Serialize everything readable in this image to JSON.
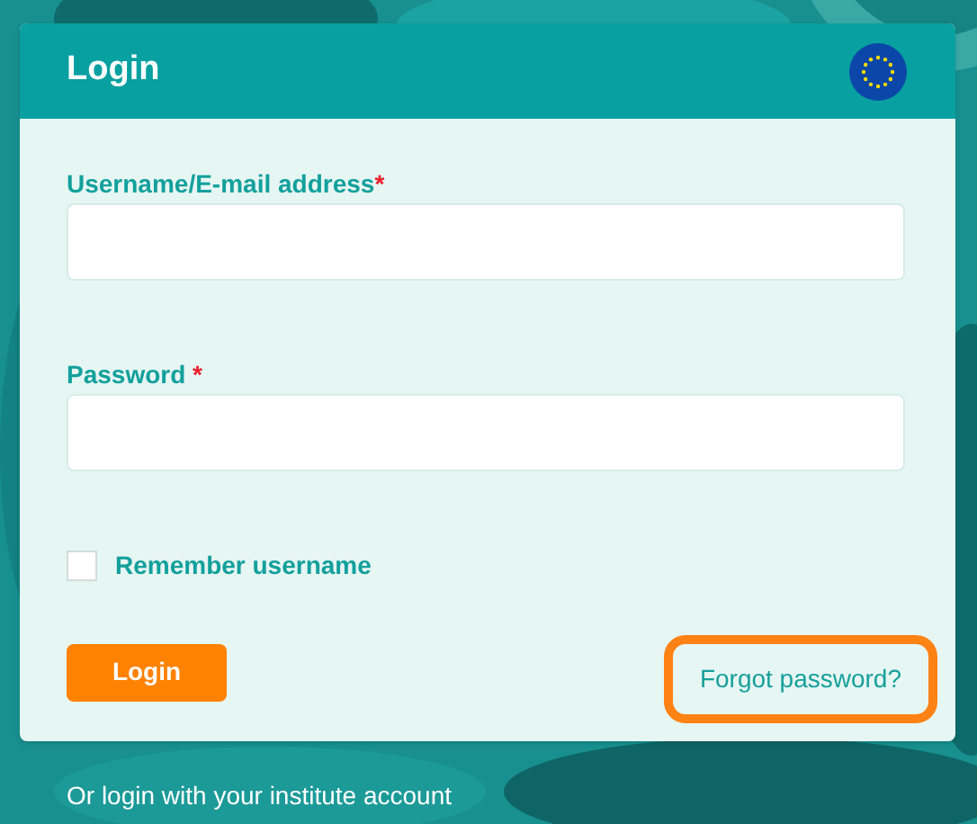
{
  "card": {
    "title": "Login"
  },
  "fields": [
    {
      "label": "Username/E-mail address",
      "required_mark": "*"
    },
    {
      "label": "Password ",
      "required_mark": "*"
    }
  ],
  "remember": {
    "label": "Remember username",
    "checked": false
  },
  "login_button": "Login",
  "forgot_link": {
    "label": "Forgot password?",
    "highlighted": true
  },
  "footer_text": "Or login with your institute account"
}
